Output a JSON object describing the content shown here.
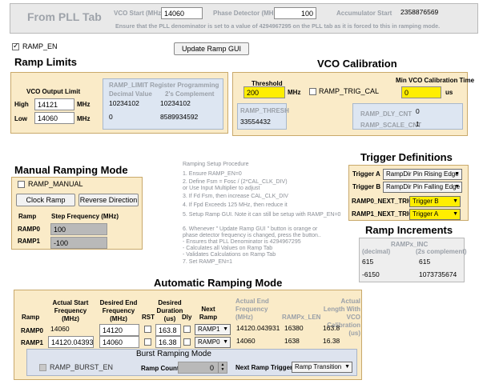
{
  "top_bar": {
    "title": "From PLL Tab",
    "vco_start_label": "VCO Start (MHz)",
    "vco_start_value": "14060",
    "phase_detector_label": "Phase Detector (MHz)",
    "phase_detector_value": "100",
    "accumulator_start_label": "Accumulator Start",
    "accumulator_start_value": "2358876569",
    "notice": "Ensure that the PLL denominator is set to a value of 4294967295 on the PLL tab as it is forced to this in ramping mode."
  },
  "ramp_en": {
    "label": "RAMP_EN",
    "checked": true
  },
  "update_button": "Update Ramp GUI",
  "ramp_limits": {
    "title": "Ramp Limits",
    "vco_output_limit_label": "VCO Output Limit",
    "high_label": "High",
    "high_value": "14121",
    "low_label": "Low",
    "low_value": "14060",
    "unit": "MHz",
    "register_title": "RAMP_LIMIT Register Programming",
    "decimal_label": "Decimal Value",
    "complement_label": "2's Complement",
    "high_decimal": "10234102",
    "high_complement": "10234102",
    "low_decimal": "0",
    "low_complement": "8589934592"
  },
  "vco_calibration": {
    "title": "VCO Calibration",
    "threshold_label": "Threshold",
    "threshold_value": "200",
    "threshold_unit": "MHz",
    "trig_cal_label": "RAMP_TRIG_CAL",
    "min_cal_time_label": "Min VCO Calibration Time",
    "min_cal_time_value": "0",
    "min_cal_time_unit": "us",
    "ramp_thresh_label": "RAMP_THRESH",
    "ramp_thresh_value": "33554432",
    "dly_cnt_label": "RAMP_DLY_CNT",
    "dly_cnt_value": "0",
    "scale_cnt_label": "RAMP_SCALE_CNT",
    "scale_cnt_value": "1"
  },
  "trigger_definitions": {
    "title": "Trigger Definitions",
    "trigger_a_label": "Trigger A",
    "trigger_a_value": "RampDir Pin Rising Edge",
    "trigger_b_label": "Trigger B",
    "trigger_b_value": "RampDir Pin Falling Edge",
    "ramp0_next_trig_label": "RAMP0_NEXT_TRIG",
    "ramp0_next_trig_value": "Trigger B",
    "ramp1_next_trig_label": "RAMP1_NEXT_TRIG",
    "ramp1_next_trig_value": "Trigger A"
  },
  "ramp_increments": {
    "title": "Ramp Increments",
    "header": "RAMPx_INC",
    "col1": "(decimal)",
    "col2": "(2s complement)",
    "rows": [
      {
        "decimal": "615",
        "complement": "615"
      },
      {
        "decimal": "-6150",
        "complement": "1073735674"
      }
    ]
  },
  "manual_ramping": {
    "title": "Manual Ramping Mode",
    "ramp_manual_label": "RAMP_MANUAL",
    "clock_ramp_button": "Clock Ramp",
    "reverse_direction_button": "Reverse Direction",
    "ramp_col": "Ramp",
    "step_col": "Step Frequency (MHz)",
    "rows": [
      {
        "ramp": "RAMP0",
        "step": "100"
      },
      {
        "ramp": "RAMP1",
        "step": "-100"
      }
    ]
  },
  "procedure": {
    "title": "Ramping Setup Procedure",
    "lines": [
      "1.  Ensure RAMP_EN=0",
      "2.  Define  Fsm = Fosc / (2*CAL_CLK_DIV)",
      "      or Use Input Multiplier to adjust",
      "3.  If Fd    Fsm, then increase CAL_CLK_DIV",
      "4.  If Fpd Exceeds 125 MHz, then reduce it",
      "5.  Setup Ramp GUI.  Note it can still be setup with RAMP_EN=0",
      "6.  Whenever \" Update Ramp GUI \" button is orange or",
      "      phase detector frequency is changed, press the button..",
      "      - Ensures that PLL Denominator is 4294967295",
      "      - Calculates all Values on Ramp Tab",
      "      - Validates Calculations on Ramp Tab",
      "7.  Set RAMP_EN=1"
    ]
  },
  "automatic_ramping": {
    "title": "Automatic Ramping Mode",
    "headers": {
      "ramp": "Ramp",
      "actual_start": "Actual Start Frequency (MHz)",
      "desired_end": "Desired End Frequency (MHz)",
      "rst": "RST",
      "desired_duration": "Desired Duration (us)",
      "dly": "Dly",
      "next_ramp": "Next Ramp",
      "actual_end": "Actual End Frequency (MHz)",
      "rampx_len": "RAMPx_LEN",
      "actual_length": "Actual Length With VCO Calibration (us)"
    },
    "rows": [
      {
        "ramp": "RAMP0",
        "actual_start": "14060",
        "desired_end": "14120",
        "duration": "163.8",
        "next": "RAMP1",
        "actual_end": "14120.043931",
        "len": "16380",
        "actual_length": "163.8"
      },
      {
        "ramp": "RAMP1",
        "actual_start": "14120.043931",
        "desired_end": "14060",
        "duration": "16.38",
        "next": "RAMP0",
        "actual_end": "14060",
        "len": "1638",
        "actual_length": "16.38"
      }
    ],
    "burst": {
      "title": "Burst Ramping Mode",
      "burst_en_label": "RAMP_BURST_EN",
      "ramp_count_label": "Ramp Count",
      "ramp_count_value": "0",
      "next_trigger_label": "Next Ramp Trigger",
      "next_trigger_value": "Ramp Transition"
    }
  }
}
